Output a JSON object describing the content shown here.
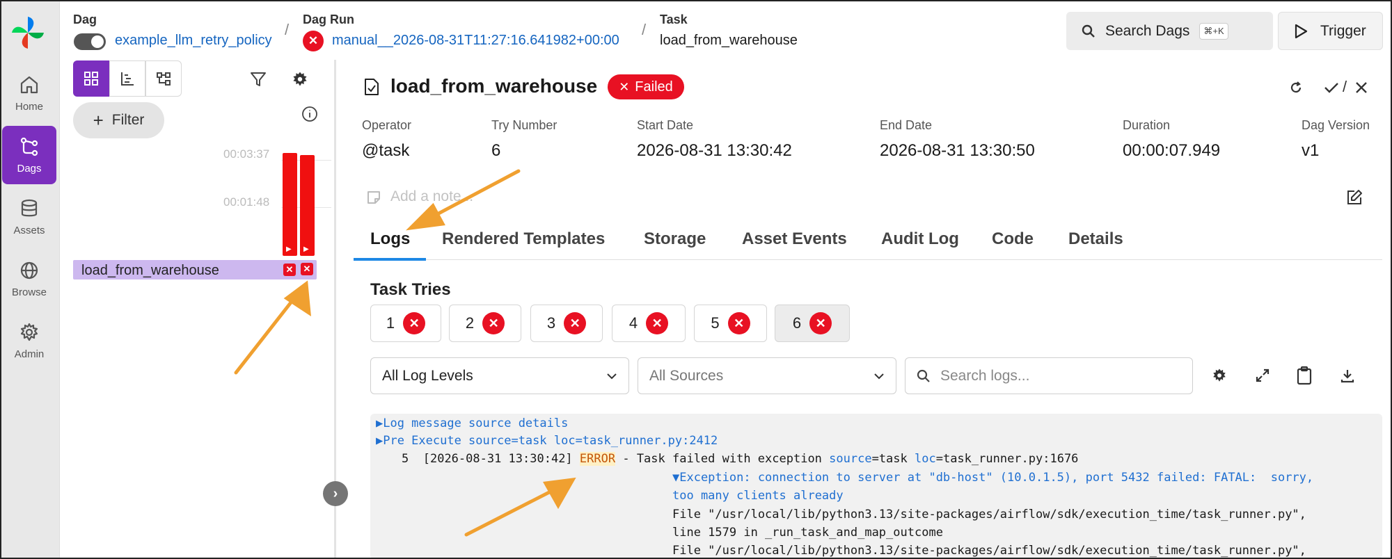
{
  "nav": {
    "items": [
      {
        "label": "Home",
        "icon": "home-icon"
      },
      {
        "label": "Dags",
        "icon": "dags-icon",
        "active": true
      },
      {
        "label": "Assets",
        "icon": "assets-icon"
      },
      {
        "label": "Browse",
        "icon": "browse-icon"
      },
      {
        "label": "Admin",
        "icon": "gear-icon"
      }
    ]
  },
  "breadcrumb": {
    "dag_label": "Dag",
    "dag_name": "example_llm_retry_policy",
    "dagrun_label": "Dag Run",
    "dagrun_id": "manual__2026-08-31T11:27:16.641982+00:00",
    "task_label": "Task",
    "task_name": "load_from_warehouse",
    "separator": "/"
  },
  "header": {
    "search_label": "Search Dags",
    "search_shortcut": "⌘+K",
    "trigger_label": "Trigger"
  },
  "grid": {
    "filter_label": "Filter",
    "durations": [
      "00:03:37",
      "00:01:48"
    ],
    "task_row_label": "load_from_warehouse",
    "run_bars": [
      3.62,
      3.6
    ]
  },
  "task": {
    "title": "load_from_warehouse",
    "status": "Failed",
    "meta": [
      {
        "label": "Operator",
        "value": "@task"
      },
      {
        "label": "Try Number",
        "value": "6"
      },
      {
        "label": "Start Date",
        "value": "2026-08-31 13:30:42"
      },
      {
        "label": "End Date",
        "value": "2026-08-31 13:30:50"
      },
      {
        "label": "Duration",
        "value": "00:00:07.949"
      },
      {
        "label": "Dag Version",
        "value": "v1"
      }
    ],
    "note_placeholder": "Add a note...",
    "check_sep": "/"
  },
  "tabs": [
    "Logs",
    "Rendered Templates",
    "Storage",
    "Asset Events",
    "Audit Log",
    "Code",
    "Details"
  ],
  "tries": {
    "title": "Task Tries",
    "items": [
      "1",
      "2",
      "3",
      "4",
      "5",
      "6"
    ],
    "selected": "6"
  },
  "log_filters": {
    "level": "All Log Levels",
    "sources": "All Sources",
    "search_placeholder": "Search logs..."
  },
  "logs": {
    "line1": "▶Log message source details",
    "line2": "▶Pre Execute source=task loc=task_runner.py:2412",
    "line3_num": "5",
    "line3_ts": "[2026-08-31 13:30:42]",
    "line3_level": "ERROR",
    "line3_msg": " - Task failed with exception ",
    "line3_k1": "source",
    "line3_v1": "=task ",
    "line3_k2": "loc",
    "line3_v2": "=task_runner.py:1676",
    "exc1": "▼Exception: connection to server at \"db-host\" (10.0.1.5), port 5432 failed: FATAL:  sorry,",
    "exc2": "too many clients already",
    "trace1": "File \"/usr/local/lib/python3.13/site-packages/airflow/sdk/execution_time/task_runner.py\",",
    "trace2": "line 1579 in _run_task_and_map_outcome",
    "trace3": "File \"/usr/local/lib/python3.13/site-packages/airflow/sdk/execution_time/task_runner.py\","
  },
  "colors": {
    "accent": "#7b2fbe",
    "failed": "#e81123",
    "link": "#1565c0",
    "annotation_arrow": "#f0a030"
  }
}
